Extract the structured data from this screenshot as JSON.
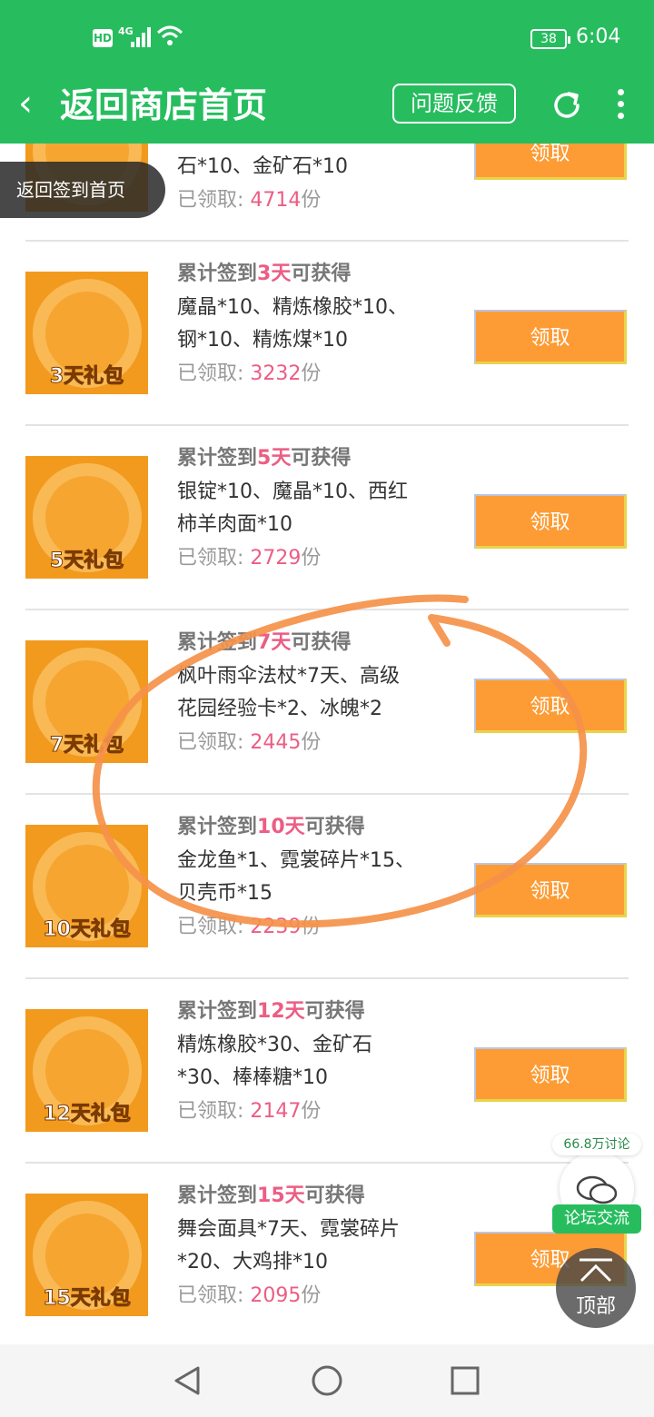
{
  "status_bar": {
    "hd": "HD",
    "signal": "4G",
    "battery": "38",
    "time": "6:04"
  },
  "header": {
    "title": "返回商店首页",
    "feedback_label": "问题反馈"
  },
  "floating": {
    "back_sign_label": "返回签到首页",
    "forum_count": "66.8万讨论",
    "forum_label": "论坛交流",
    "top_label": "顶部"
  },
  "partial_item": {
    "reward": "石*10、金矿石*10",
    "claimed_prefix": "已领取: ",
    "claimed_count": "4714",
    "claimed_suffix": "份",
    "button": "领取"
  },
  "items": [
    {
      "headline_pre": "累计签到",
      "days": "3天",
      "headline_post": "可获得",
      "reward_l1": "魔晶*10、精炼橡胶*10、",
      "reward_l2": "钢*10、精炼煤*10",
      "claimed_prefix": "已领取: ",
      "claimed_count": "3232",
      "claimed_suffix": "份",
      "button": "领取",
      "icon_label": "3天礼包"
    },
    {
      "headline_pre": "累计签到",
      "days": "5天",
      "headline_post": "可获得",
      "reward_l1": "银锭*10、魔晶*10、西红",
      "reward_l2": "柿羊肉面*10",
      "claimed_prefix": "已领取: ",
      "claimed_count": "2729",
      "claimed_suffix": "份",
      "button": "领取",
      "icon_label": "5天礼包"
    },
    {
      "headline_pre": "累计签到",
      "days": "7天",
      "headline_post": "可获得",
      "reward_l1": "枫叶雨伞法杖*7天、高级",
      "reward_l2": "花园经验卡*2、冰魄*2",
      "claimed_prefix": "已领取: ",
      "claimed_count": "2445",
      "claimed_suffix": "份",
      "button": "领取",
      "icon_label": "7天礼包"
    },
    {
      "headline_pre": "累计签到",
      "days": "10天",
      "headline_post": "可获得",
      "reward_l1": "金龙鱼*1、霓裳碎片*15、",
      "reward_l2": "贝壳币*15",
      "claimed_prefix": "已领取: ",
      "claimed_count": "2239",
      "claimed_suffix": "份",
      "button": "领取",
      "icon_label": "10天礼包"
    },
    {
      "headline_pre": "累计签到",
      "days": "12天",
      "headline_post": "可获得",
      "reward_l1": "精炼橡胶*30、金矿石",
      "reward_l2": "*30、棒棒糖*10",
      "claimed_prefix": "已领取: ",
      "claimed_count": "2147",
      "claimed_suffix": "份",
      "button": "领取",
      "icon_label": "12天礼包"
    },
    {
      "headline_pre": "累计签到",
      "days": "15天",
      "headline_post": "可获得",
      "reward_l1": "舞会面具*7天、霓裳碎片",
      "reward_l2": "*20、大鸡排*10",
      "claimed_prefix": "已领取: ",
      "claimed_count": "2095",
      "claimed_suffix": "份",
      "button": "领取",
      "icon_label": "15天礼包"
    }
  ],
  "colors": {
    "header_green": "#27bd5f",
    "button_orange": "#fd9c35",
    "highlight_pink": "#ec5d84",
    "annotation_orange": "#f5914a"
  }
}
